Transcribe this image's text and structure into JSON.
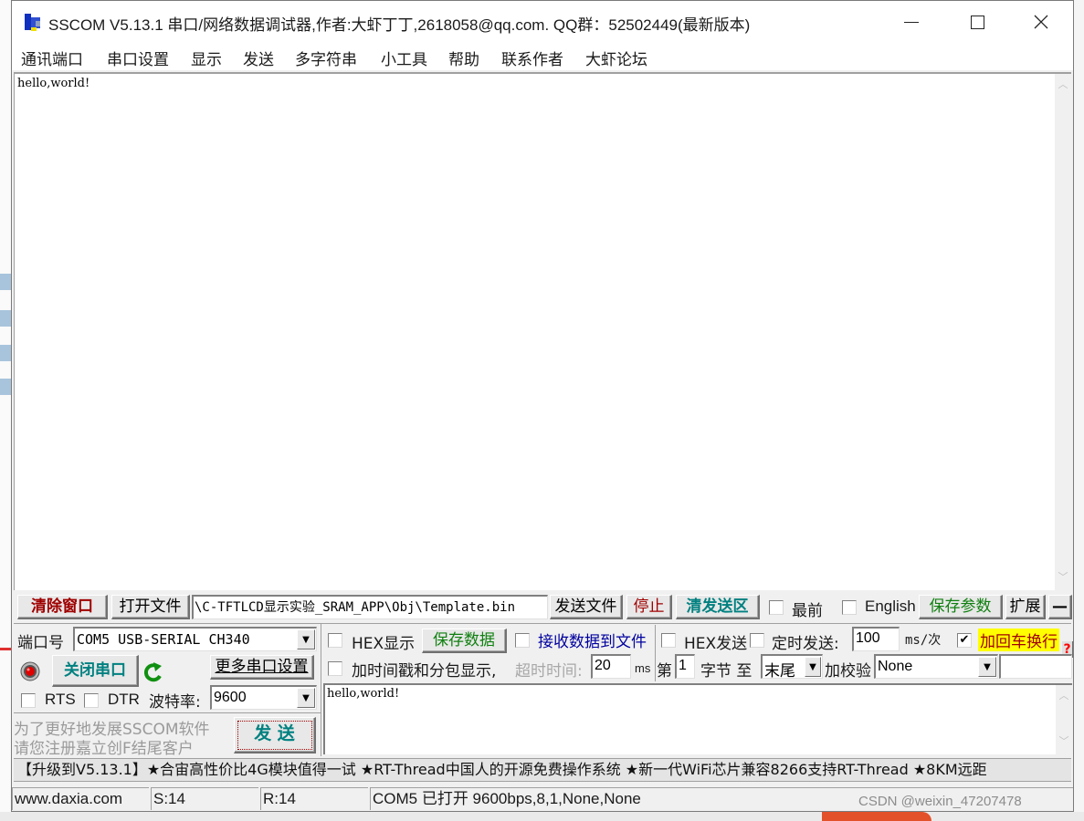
{
  "window": {
    "title": "SSCOM V5.13.1 串口/网络数据调试器,作者:大虾丁丁,2618058@qq.com. QQ群：52502449(最新版本)",
    "minimize_icon": "minimize-icon",
    "maximize_icon": "maximize-icon",
    "close_icon": "close-icon"
  },
  "menu": [
    {
      "label": "通讯端口"
    },
    {
      "label": "串口设置"
    },
    {
      "label": "显示"
    },
    {
      "label": "发送"
    },
    {
      "label": "多字符串"
    },
    {
      "label": "小工具"
    },
    {
      "label": "帮助"
    },
    {
      "label": "联系作者"
    },
    {
      "label": "大虾论坛"
    }
  ],
  "receive": {
    "text": "hello,world!"
  },
  "toolbar": {
    "clear_window": "清除窗口",
    "open_file": "打开文件",
    "file_path": "\\C-TFTLCD显示实验_SRAM_APP\\Obj\\Template.bin",
    "send_file": "发送文件",
    "stop": "停止",
    "clear_send": "清发送区",
    "topmost_label": "最前",
    "topmost_checked": false,
    "english_label": "English",
    "english_checked": false,
    "save_params": "保存参数",
    "expand": "扩展",
    "collapse": "—"
  },
  "port": {
    "port_label": "端口号",
    "port_value": "COM5 USB-SERIAL CH340",
    "close_port": "关闭串口",
    "more_settings": "更多串口设置",
    "rts_label": "RTS",
    "rts_checked": false,
    "dtr_label": "DTR",
    "dtr_checked": false,
    "baud_label": "波特率:",
    "baud_value": "9600",
    "promo_line1": "为了更好地发展SSCOM软件",
    "promo_line2": "请您注册嘉立创F结尾客户",
    "send_button": "发  送"
  },
  "options": {
    "hex_display_label": "HEX显示",
    "hex_display_checked": false,
    "save_data": "保存数据",
    "recv_to_file_label": "接收数据到文件",
    "recv_to_file_checked": false,
    "hex_send_label": "HEX发送",
    "hex_send_checked": false,
    "timed_send_label": "定时发送:",
    "timed_send_checked": false,
    "timed_interval": "100",
    "timed_unit": "ms/次",
    "add_crlf_label": "加回车换行",
    "add_crlf_checked": true,
    "help_icon": "?",
    "timestamp_label": "加时间戳和分包显示,",
    "timestamp_checked": false,
    "timeout_label": "超时时间:",
    "timeout_value": "20",
    "timeout_unit": "ms",
    "byte_prefix": "第",
    "byte_from": "1",
    "byte_suffix": "字节 至",
    "byte_to": "末尾",
    "checksum_label": "加校验",
    "checksum_value": "None",
    "extra_value": ""
  },
  "send": {
    "text": "hello,world!"
  },
  "ticker": {
    "text": "【升级到V5.13.1】★合宙高性价比4G模块值得一试 ★RT-Thread中国人的开源免费操作系统 ★新一代WiFi芯片兼容8266支持RT-Thread ★8KM远距"
  },
  "status": {
    "website": "www.daxia.com",
    "sent": "S:14",
    "received": "R:14",
    "port_state": "COM5 已打开  9600bps,8,1,None,None"
  },
  "watermark": "CSDN @weixin_47207478",
  "colors": {
    "clear_red": "#a00000",
    "teal": "#008080",
    "green": "#008000",
    "navy": "#000080",
    "highlight_yellow": "#ffff00",
    "help_red": "#ff0000"
  }
}
